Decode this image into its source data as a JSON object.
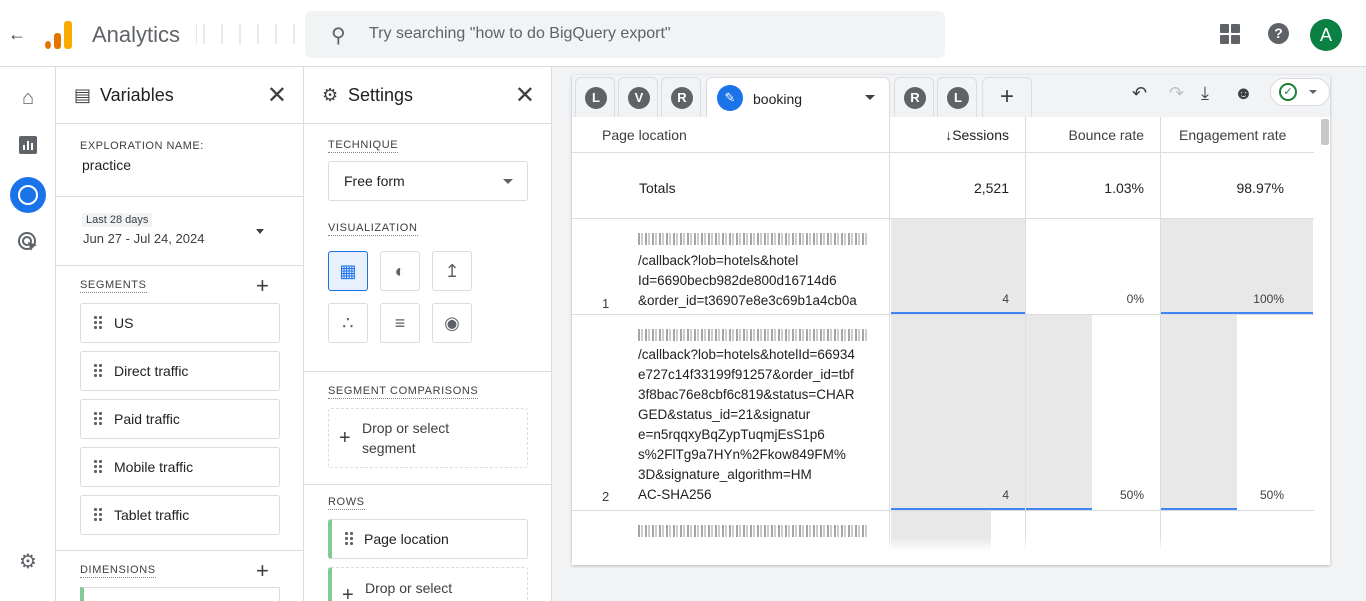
{
  "topbar": {
    "app_title": "Analytics",
    "search_placeholder": "Try searching \"how to do BigQuery export\"",
    "avatar_letter": "A",
    "help_label": "?"
  },
  "variables": {
    "title": "Variables",
    "exploration_name_label": "EXPLORATION NAME:",
    "exploration_name": "practice",
    "date_badge": "Last 28 days",
    "date_range": "Jun 27 - Jul 24, 2024",
    "segments_label": "SEGMENTS",
    "segments": [
      "US",
      "Direct traffic",
      "Paid traffic",
      "Mobile traffic",
      "Tablet traffic"
    ],
    "dimensions_label": "DIMENSIONS"
  },
  "settings": {
    "title": "Settings",
    "technique_label": "TECHNIQUE",
    "technique_value": "Free form",
    "visualization_label": "VISUALIZATION",
    "segment_comparisons_label": "SEGMENT COMPARISONS",
    "drop_segment_line1": "Drop or select",
    "drop_segment_line2": "segment",
    "rows_label": "ROWS",
    "row_item": "Page location",
    "drop_row": "Drop or select"
  },
  "tabs": {
    "left_circles": [
      "L",
      "V",
      "R"
    ],
    "active": "booking",
    "right_circles": [
      "R",
      "L"
    ],
    "add": "+"
  },
  "table": {
    "headers": {
      "dimension": "Page location",
      "sessions": "↓Sessions",
      "bounce": "Bounce rate",
      "engagement": "Engagement rate"
    },
    "totals_label": "Totals",
    "totals": {
      "sessions": "2,521",
      "bounce": "1.03%",
      "engagement": "98.97%"
    },
    "rows": [
      {
        "index": "1",
        "url_lines": [
          "/callback?lob=hotels&hotel",
          "Id=6690becb982de800d16714d6",
          "&order_id=t36907e8e3c69b1a4cb0a"
        ],
        "sessions": "4",
        "bounce": "0%",
        "engagement": "100%",
        "sessions_share": 1.0,
        "bounce_share": 0.0,
        "engagement_share": 1.0
      },
      {
        "index": "2",
        "url_lines": [
          "/callback?lob=hotels&hotelId=66934",
          "e727c14f33199f91257&order_id=tbf",
          "3f8bac76e8cbf6c819&status=CHAR",
          "GED&status_id=21&signatur",
          "e=n5rqqxyBqZypTuqmjEsS1p6",
          "s%2FlTg9a7HYn%2Fkow849FM%",
          "3D&signature_algorithm=HM",
          "AC-SHA256"
        ],
        "sessions": "4",
        "bounce": "50%",
        "engagement": "50%",
        "sessions_share": 1.0,
        "bounce_share": 0.5,
        "engagement_share": 0.5
      }
    ]
  },
  "colors": {
    "accent": "#1a73e8",
    "avatar": "#0b8043",
    "status_ok": "#188038",
    "row_chip_accent": "#81c995"
  },
  "icons": {
    "back": "arrow-left-icon",
    "search": "search-icon",
    "apps": "apps-grid-icon",
    "help": "help-icon",
    "home": "home-icon",
    "reports": "bar-chart-icon",
    "explore": "explore-icon",
    "advertising": "target-click-icon",
    "admin": "gear-icon"
  }
}
